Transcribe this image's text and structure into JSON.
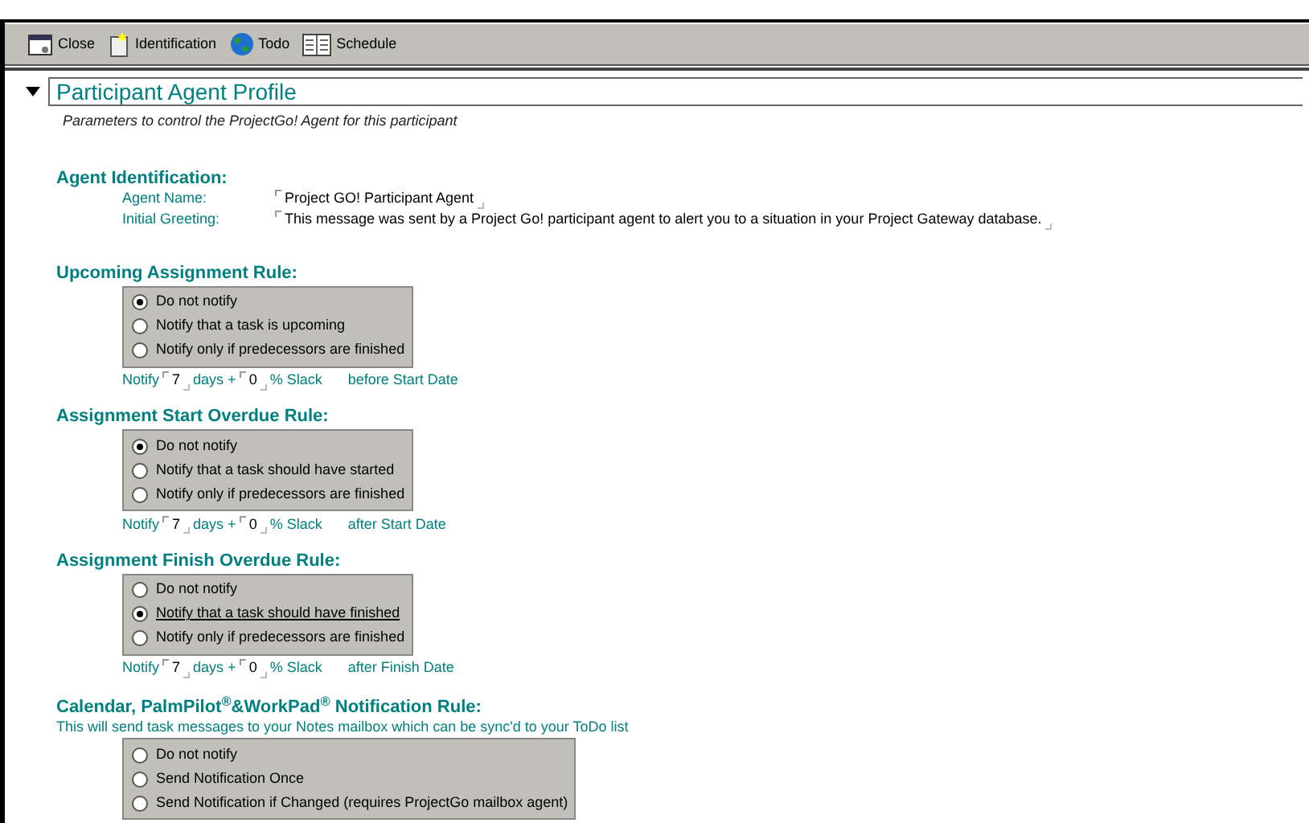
{
  "toolbar": [
    {
      "label": "Close",
      "kind": "close"
    },
    {
      "label": "Identification",
      "kind": "doc"
    },
    {
      "label": "Todo",
      "kind": "globe"
    },
    {
      "label": "Schedule",
      "kind": "schedule"
    }
  ],
  "section": {
    "title": "Participant Agent Profile",
    "expanded": true,
    "subtitle": "Parameters to control the ProjectGo! Agent for this participant"
  },
  "identification": {
    "heading": "Agent Identification:",
    "fields": [
      {
        "label": "Agent Name:",
        "value": "Project GO! Participant Agent"
      },
      {
        "label": "Initial Greeting:",
        "value": "This message was sent by a Project Go! participant agent to alert you to a situation in your Project Gateway database."
      }
    ]
  },
  "rules": [
    {
      "heading": "Upcoming Assignment Rule:",
      "options": [
        {
          "label": "Do not notify",
          "selected": true
        },
        {
          "label": "Notify that a task is upcoming",
          "selected": false
        },
        {
          "label": "Notify only if predecessors are finished",
          "selected": false
        }
      ],
      "notify": {
        "prefix": "Notify",
        "days": "7",
        "days_label": "days +",
        "slack": "0",
        "slack_label": "% Slack",
        "suffix": "before Start Date"
      }
    },
    {
      "heading": "Assignment Start Overdue Rule:",
      "options": [
        {
          "label": "Do not notify",
          "selected": true
        },
        {
          "label": "Notify that a task should have started",
          "selected": false
        },
        {
          "label": "Notify only if predecessors are finished",
          "selected": false
        }
      ],
      "notify": {
        "prefix": "Notify",
        "days": "7",
        "days_label": "days +",
        "slack": "0",
        "slack_label": "% Slack",
        "suffix": "after Start Date"
      }
    },
    {
      "heading": "Assignment Finish Overdue Rule:",
      "options": [
        {
          "label": "Do not notify",
          "selected": false
        },
        {
          "label": "Notify that a task should have finished",
          "selected": true
        },
        {
          "label": "Notify only if predecessors are finished",
          "selected": false
        }
      ],
      "notify": {
        "prefix": "Notify",
        "days": "7",
        "days_label": "days +",
        "slack": "0",
        "slack_label": "% Slack",
        "suffix": "after Finish Date"
      }
    },
    {
      "heading": "Calendar, PalmPilot$^{®}$&WorkPad$^{®}$ Notification Rule:",
      "note": "This will send task messages to your Notes mailbox which can be sync'd to your ToDo list",
      "options": [
        {
          "label": "Do not notify",
          "selected": false
        },
        {
          "label": "Send Notification Once",
          "selected": false
        },
        {
          "label": "Send Notification if Changed (requires ProjectGo mailbox agent)",
          "selected": false
        }
      ]
    }
  ]
}
